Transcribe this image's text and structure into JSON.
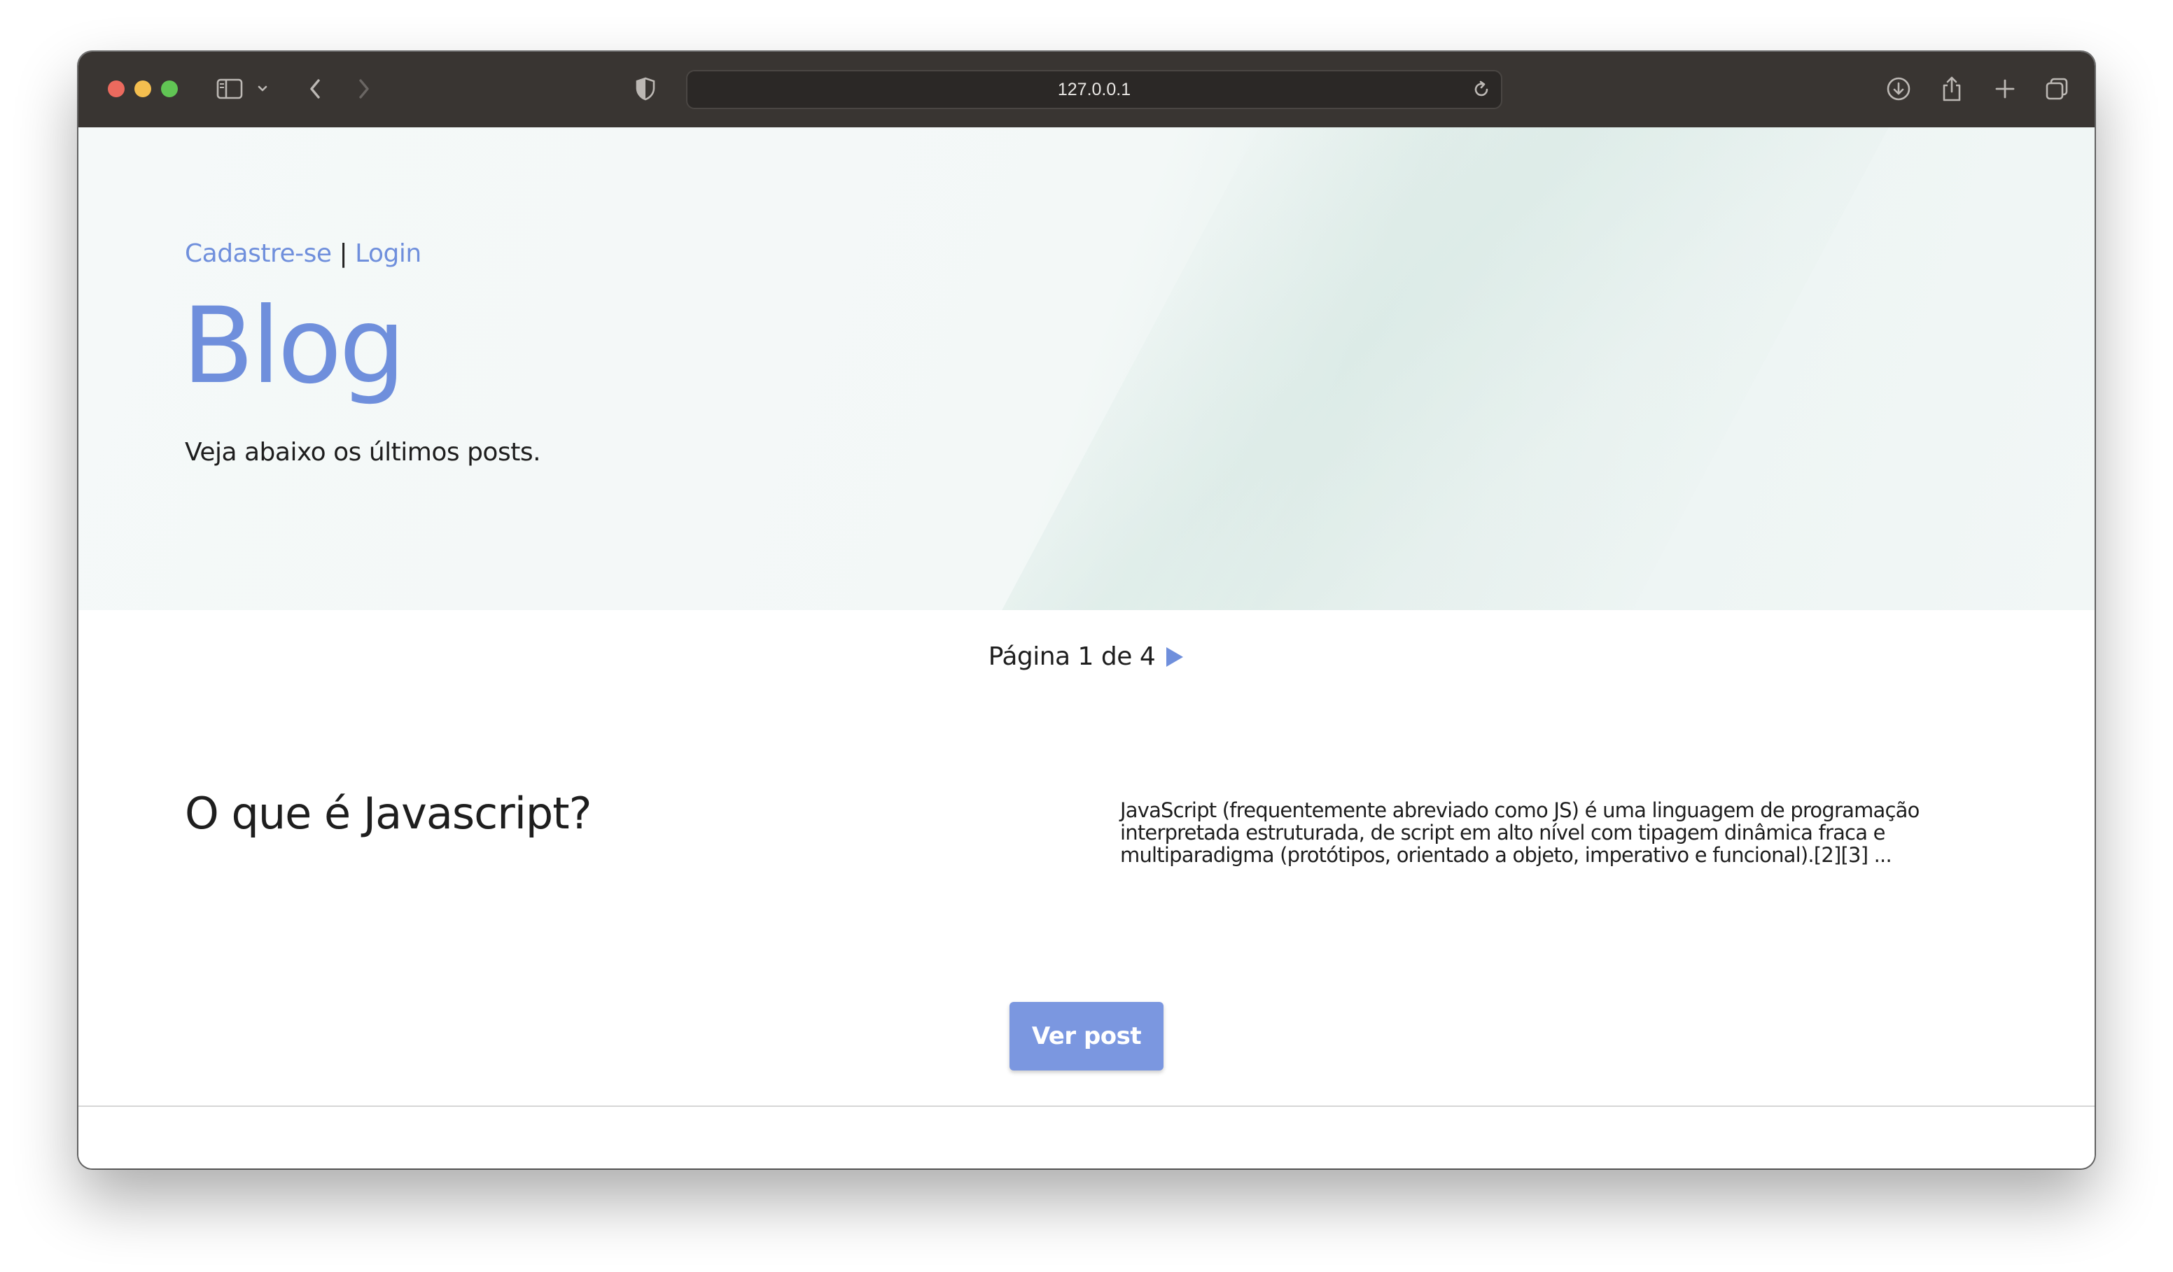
{
  "browser": {
    "url": "127.0.0.1",
    "icons": {
      "sidebar": "sidebar-icon",
      "sidebar_menu": "chevron-down-icon",
      "back": "chevron-left-icon",
      "forward": "chevron-right-icon",
      "privacy": "shield-icon",
      "reload": "reload-icon",
      "downloads": "download-icon",
      "share": "share-icon",
      "new_tab": "plus-icon",
      "tab_overview": "tabs-icon"
    }
  },
  "header": {
    "signup_label": "Cadastre-se",
    "separator": "|",
    "login_label": "Login",
    "title": "Blog",
    "subtitle": "Veja abaixo os últimos posts."
  },
  "pagination": {
    "label": "Página 1 de 4",
    "next_icon": "play-arrow-icon"
  },
  "posts": [
    {
      "title": "O que é Javascript?",
      "excerpt": "JavaScript (frequentemente abreviado como JS) é uma linguagem de programação interpretada estruturada, de script em alto nível com tipagem dinâmica fraca e multiparadigma (protótipos, orientado a objeto, imperativo e funcional).[2][3] ...",
      "button_label": "Ver post"
    }
  ],
  "colors": {
    "accent": "#6f8fdc",
    "button": "#7b97e0",
    "titlebar": "#393532",
    "text": "#1e1e1e"
  }
}
